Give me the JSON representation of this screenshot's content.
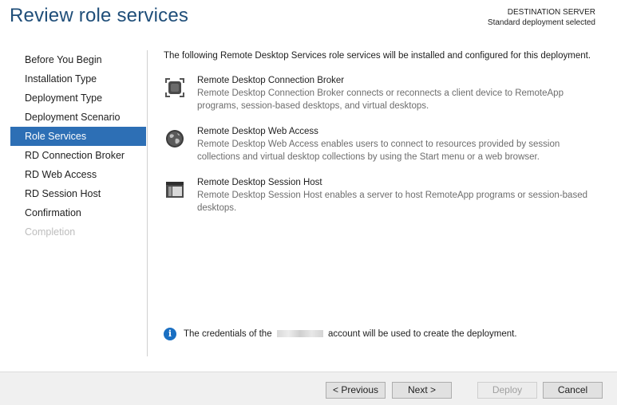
{
  "header": {
    "title": "Review role services",
    "destination_label": "DESTINATION SERVER",
    "destination_value": "Standard deployment selected"
  },
  "nav": {
    "items": [
      {
        "label": "Before You Begin"
      },
      {
        "label": "Installation Type"
      },
      {
        "label": "Deployment Type"
      },
      {
        "label": "Deployment Scenario"
      },
      {
        "label": "Role Services",
        "active": true
      },
      {
        "label": "RD Connection Broker"
      },
      {
        "label": "RD Web Access"
      },
      {
        "label": "RD Session Host"
      },
      {
        "label": "Confirmation"
      },
      {
        "label": "Completion",
        "disabled": true
      }
    ]
  },
  "content": {
    "intro": "The following Remote Desktop Services role services will be installed and configured for this deployment.",
    "services": [
      {
        "icon": "connection-broker-icon",
        "name": "Remote Desktop Connection Broker",
        "description": "Remote Desktop Connection Broker connects or reconnects a client device to RemoteApp programs, session-based desktops, and virtual desktops."
      },
      {
        "icon": "web-access-globe-icon",
        "name": "Remote Desktop Web Access",
        "description": "Remote Desktop Web Access enables users to connect to resources provided by session collections and virtual desktop collections by using the Start menu or a web browser."
      },
      {
        "icon": "session-host-icon",
        "name": "Remote Desktop Session Host",
        "description": "Remote Desktop Session Host enables a server to host RemoteApp programs or session-based desktops."
      }
    ],
    "info_prefix": "The credentials of the",
    "info_suffix": "account will be used to create the deployment."
  },
  "footer": {
    "previous_label": "< Previous",
    "next_label": "Next >",
    "deploy_label": "Deploy",
    "cancel_label": "Cancel"
  }
}
